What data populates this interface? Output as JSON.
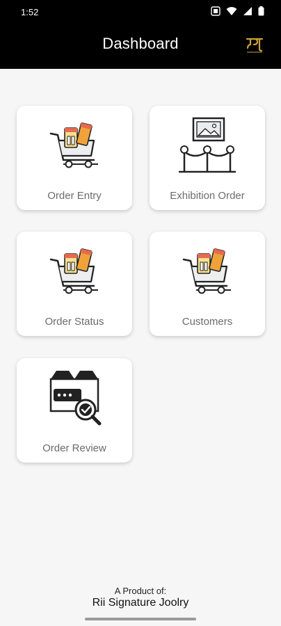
{
  "status_bar": {
    "time": "1:52"
  },
  "header": {
    "title": "Dashboard"
  },
  "tiles": [
    {
      "label": "Order Entry",
      "icon": "shopping-cart-icon"
    },
    {
      "label": "Exhibition Order",
      "icon": "exhibition-frame-icon"
    },
    {
      "label": "Order Status",
      "icon": "shopping-cart-icon"
    },
    {
      "label": "Customers",
      "icon": "shopping-cart-icon"
    },
    {
      "label": "Order Review",
      "icon": "package-review-icon"
    }
  ],
  "footer": {
    "caption": "A Product of:",
    "brand": "Rii Signature Joolry"
  },
  "colors": {
    "appbar": "#000000",
    "logo": "#c9a23b",
    "cart_orange": "#f0a23a",
    "cart_peach": "#f7c79b",
    "cart_yellow": "#f7df8e",
    "cart_red": "#e56a4f"
  }
}
